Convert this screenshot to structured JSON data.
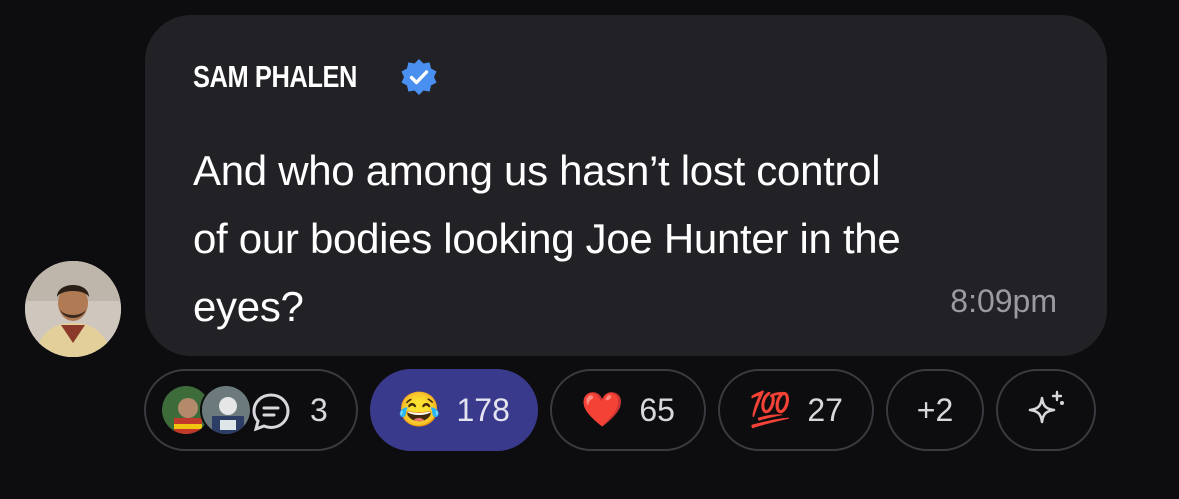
{
  "post": {
    "author": "SAM PHALEN",
    "verified": true,
    "message_lines": [
      "And who among us hasn’t lost control",
      "of our bodies looking Joe Hunter in the",
      "eyes?"
    ],
    "timestamp": "8:09pm"
  },
  "reactions": {
    "replies": {
      "icon": "chat-bubble-icon",
      "count": "3"
    },
    "items": [
      {
        "icon": "tears-of-joy-emoji",
        "glyph": "😂",
        "count": "178",
        "active": true
      },
      {
        "icon": "red-heart-emoji",
        "glyph": "❤️",
        "count": "65",
        "active": false
      },
      {
        "icon": "hundred-points-emoji",
        "glyph": "💯",
        "count": "27",
        "active": false
      }
    ],
    "more": "+2",
    "add": {
      "icon": "sparkles-icon"
    }
  },
  "colors": {
    "background": "#0d0d0f",
    "bubble": "#222226",
    "verified_badge": "#4a90f0",
    "active_pill": "#3a3a8c",
    "timestamp": "#9a9aa0"
  }
}
